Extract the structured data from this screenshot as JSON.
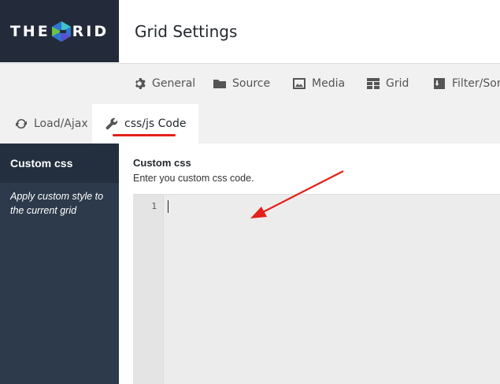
{
  "brand": {
    "logo_left": "THE",
    "logo_right": "RID"
  },
  "header": {
    "title": "Grid Settings"
  },
  "tabs": [
    {
      "label": "General",
      "icon": "gear-icon"
    },
    {
      "label": "Source",
      "icon": "folder-icon"
    },
    {
      "label": "Media",
      "icon": "image-icon"
    },
    {
      "label": "Grid",
      "icon": "grid-icon"
    },
    {
      "label": "Filter/Sort",
      "icon": "sort-icon"
    },
    {
      "label": "Load/Ajax",
      "icon": "refresh-icon"
    },
    {
      "label": "css/js Code",
      "icon": "wrench-icon",
      "active": true
    }
  ],
  "sidebar": {
    "active_item": "Custom css",
    "description": "Apply custom style to the current grid"
  },
  "main": {
    "field_title": "Custom css",
    "field_description": "Enter you custom css code."
  },
  "editor": {
    "line_number": "1",
    "content": ""
  },
  "colors": {
    "brand_dark": "#232b3a",
    "sidebar": "#2c3a4b",
    "annotation": "#e3201b"
  }
}
